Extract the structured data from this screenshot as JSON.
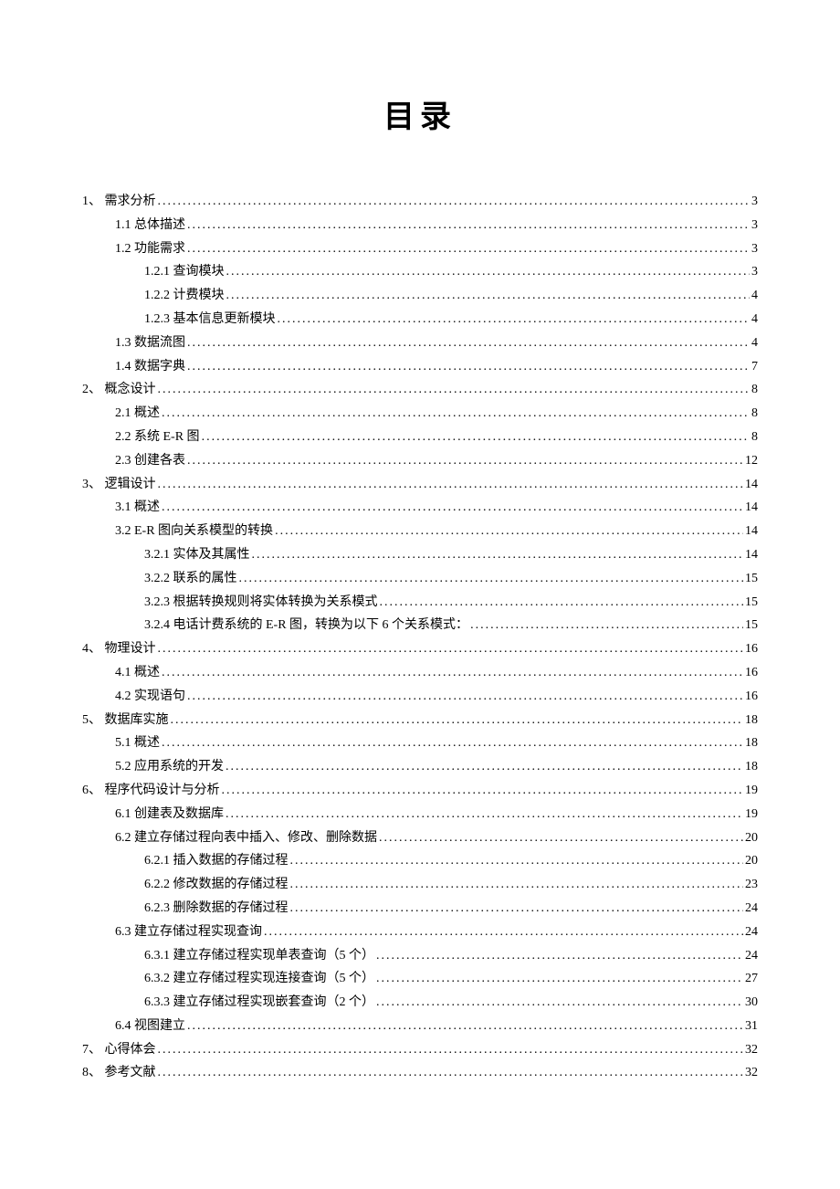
{
  "title": "目录",
  "entries": [
    {
      "level": 1,
      "num": "1、 ",
      "label": "需求分析",
      "page": "3"
    },
    {
      "level": 2,
      "num": "1.1 ",
      "label": "总体描述",
      "page": "3"
    },
    {
      "level": 2,
      "num": "1.2 ",
      "label": "功能需求",
      "page": "3"
    },
    {
      "level": 3,
      "num": "1.2.1 ",
      "label": "查询模块",
      "page": "3"
    },
    {
      "level": 3,
      "num": "1.2.2 ",
      "label": "计费模块",
      "page": "4"
    },
    {
      "level": 3,
      "num": "1.2.3 ",
      "label": "基本信息更新模块",
      "page": "4"
    },
    {
      "level": 2,
      "num": "1.3 ",
      "label": "数据流图",
      "page": "4"
    },
    {
      "level": 2,
      "num": "1.4 ",
      "label": "数据字典",
      "page": "7"
    },
    {
      "level": 1,
      "num": "2、 ",
      "label": "概念设计",
      "page": "8"
    },
    {
      "level": 2,
      "num": "2.1 ",
      "label": "概述",
      "page": "8"
    },
    {
      "level": 2,
      "num": "2.2 ",
      "label": "系统 E-R 图",
      "page": "8"
    },
    {
      "level": 2,
      "num": "2.3 ",
      "label": "创建各表",
      "page": "12"
    },
    {
      "level": 1,
      "num": "3、 ",
      "label": "逻辑设计",
      "page": "14"
    },
    {
      "level": 2,
      "num": "3.1 ",
      "label": "概述",
      "page": "14"
    },
    {
      "level": 2,
      "num": "3.2 ",
      "label": "E-R 图向关系模型的转换",
      "page": "14"
    },
    {
      "level": 3,
      "num": "3.2.1 ",
      "label": "实体及其属性",
      "page": "14"
    },
    {
      "level": 3,
      "num": "3.2.2 ",
      "label": "联系的属性",
      "page": "15"
    },
    {
      "level": 3,
      "num": "3.2.3 ",
      "label": "根据转换规则将实体转换为关系模式",
      "page": "15"
    },
    {
      "level": 3,
      "num": "3.2.4 ",
      "label": "电话计费系统的 E-R 图，转换为以下 6 个关系模式：",
      "page": "15"
    },
    {
      "level": 1,
      "num": "4、 ",
      "label": "物理设计",
      "page": "16"
    },
    {
      "level": 2,
      "num": "4.1 ",
      "label": "概述",
      "page": "16"
    },
    {
      "level": 2,
      "num": "4.2 ",
      "label": "实现语句",
      "page": "16"
    },
    {
      "level": 1,
      "num": "5、 ",
      "label": "数据库实施",
      "page": "18"
    },
    {
      "level": 2,
      "num": "5.1 ",
      "label": "概述",
      "page": "18"
    },
    {
      "level": 2,
      "num": "5.2 ",
      "label": "应用系统的开发",
      "page": "18"
    },
    {
      "level": 1,
      "num": "6、 ",
      "label": "程序代码设计与分析",
      "page": "19"
    },
    {
      "level": 2,
      "num": "6.1 ",
      "label": "创建表及数据库",
      "page": "19"
    },
    {
      "level": 2,
      "num": "6.2 ",
      "label": "建立存储过程向表中插入、修改、删除数据",
      "page": "20"
    },
    {
      "level": 3,
      "num": "6.2.1 ",
      "label": "插入数据的存储过程",
      "page": "20"
    },
    {
      "level": 3,
      "num": "6.2.2 ",
      "label": "修改数据的存储过程",
      "page": "23"
    },
    {
      "level": 3,
      "num": "6.2.3 ",
      "label": "删除数据的存储过程",
      "page": "24"
    },
    {
      "level": 2,
      "num": "6.3 ",
      "label": "建立存储过程实现查询",
      "page": "24"
    },
    {
      "level": 3,
      "num": "6.3.1 ",
      "label": "建立存储过程实现单表查询（5 个）",
      "page": "24"
    },
    {
      "level": 3,
      "num": "6.3.2 ",
      "label": "建立存储过程实现连接查询（5 个）",
      "page": "27"
    },
    {
      "level": 3,
      "num": "6.3.3 ",
      "label": "建立存储过程实现嵌套查询（2 个）",
      "page": "30"
    },
    {
      "level": 2,
      "num": "6.4 ",
      "label": "视图建立",
      "page": "31"
    },
    {
      "level": 1,
      "num": "7、 ",
      "label": "心得体会",
      "page": "32"
    },
    {
      "level": 1,
      "num": "8、 ",
      "label": "参考文献",
      "page": "32"
    }
  ]
}
